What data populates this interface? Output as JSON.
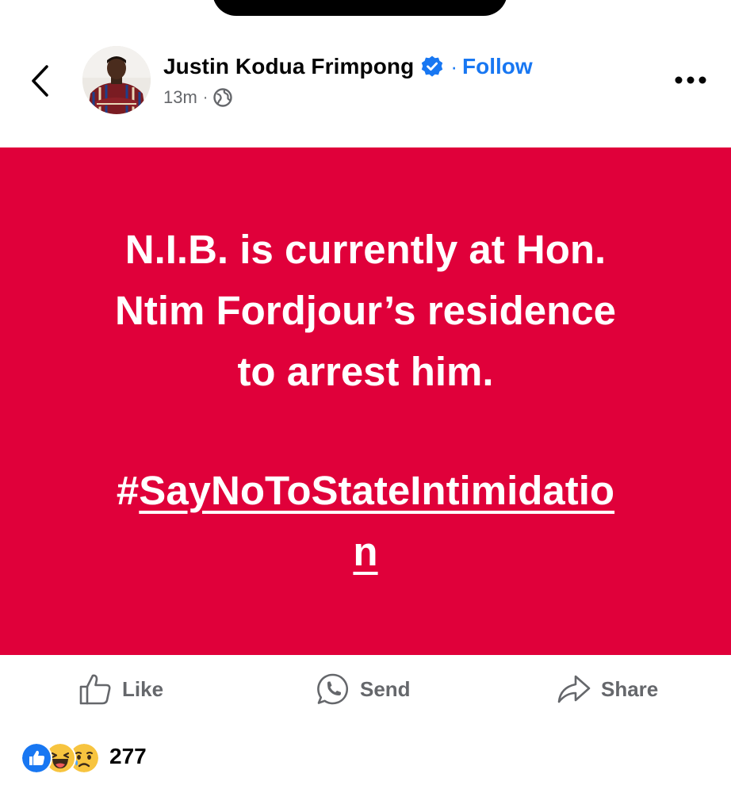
{
  "header": {
    "author_name": "Justin Kodua Frimpong",
    "separator": "·",
    "follow_label": "Follow",
    "time_ago": "13m",
    "meta_separator": "·",
    "icons": [
      "back-chevron-icon",
      "verified-badge-icon",
      "globe-icon",
      "more-options-icon"
    ]
  },
  "post": {
    "background_color": "#e0003a",
    "text_color": "#ffffff",
    "lines": [
      "N.I.B. is currently at Hon.",
      "Ntim Fordjour’s residence",
      "to arrest him."
    ],
    "hashtag_symbol": "#",
    "hashtag_line1": "SayNoToStateIntimidatio",
    "hashtag_line2": "n"
  },
  "actions": {
    "like_label": "Like",
    "send_label": "Send",
    "share_label": "Share",
    "icons": [
      "like-thumb-icon",
      "whatsapp-send-icon",
      "share-arrow-icon"
    ]
  },
  "reactions": {
    "types": [
      "like",
      "haha",
      "sad"
    ],
    "count": "277"
  },
  "colors": {
    "accent": "#1877f2",
    "muted_text": "#65676b",
    "primary_text": "#050505"
  }
}
